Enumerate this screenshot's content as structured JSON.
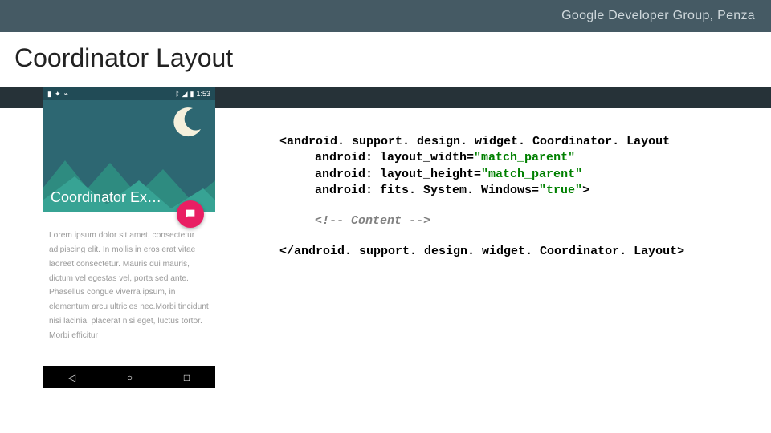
{
  "header": {
    "text": "Google Developer Group, Penza"
  },
  "title": "Coordinator Layout",
  "phone": {
    "time": "1:53",
    "heroTitle": "Coordinator Ex…",
    "body": "Lorem ipsum dolor sit amet, consectetur adipiscing elit. In mollis in eros erat vitae laoreet consectetur. Mauris dui mauris, dictum vel egestas vel, porta sed ante. Phasellus congue viverra ipsum, in elementum arcu ultricies nec.Morbi tincidunt nisi lacinia, placerat nisi eget, luctus tortor. Morbi efficitur"
  },
  "code": {
    "l1": "<android. support. design. widget. Coordinator. Layout",
    "l2a": "android: layout_width=",
    "l2b": "\"match_parent\"",
    "l3a": "android: layout_height=",
    "l3b": "\"match_parent\"",
    "l4a": "android: fits. System. Windows=",
    "l4b": "\"true\"",
    "l4c": ">",
    "l5": "<!-- Content -->",
    "l6": "</android. support. design. widget. Coordinator. Layout>"
  }
}
